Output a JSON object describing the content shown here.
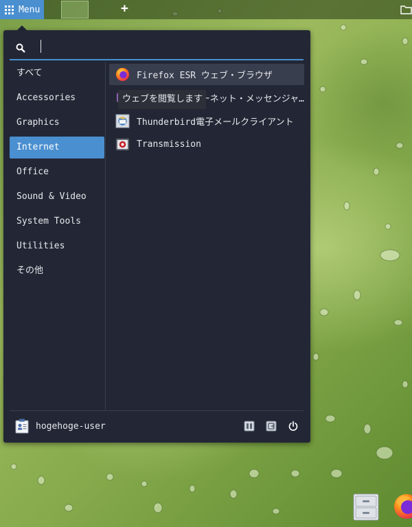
{
  "panel": {
    "menu_label": "Menu",
    "menu_icon": "app-grid-icon",
    "add_icon": "plus-icon",
    "tray_icon": "folder-icon"
  },
  "search": {
    "value": "",
    "placeholder": "",
    "icon": "search-icon"
  },
  "categories": [
    {
      "label": "すべて",
      "active": false
    },
    {
      "label": "Accessories",
      "active": false
    },
    {
      "label": "Graphics",
      "active": false
    },
    {
      "label": "Internet",
      "active": true
    },
    {
      "label": "Office",
      "active": false
    },
    {
      "label": "Sound & Video",
      "active": false
    },
    {
      "label": "System Tools",
      "active": false
    },
    {
      "label": "Utilities",
      "active": false
    },
    {
      "label": "その他",
      "active": false
    }
  ],
  "apps": [
    {
      "label": "Firefox ESR ウェブ・ブラウザ",
      "icon": "firefox-icon",
      "hovered": true
    },
    {
      "label": "Pidgin インターネット・メッセンジャー",
      "icon": "pidgin-icon",
      "hovered": false
    },
    {
      "label": "Thunderbird電子メールクライアント",
      "icon": "thunderbird-icon",
      "hovered": false
    },
    {
      "label": "Transmission",
      "icon": "transmission-icon",
      "hovered": false
    }
  ],
  "tooltip": "ウェブを閲覧します",
  "footer": {
    "user_name": "hogehoge-user",
    "user_icon": "user-card-icon",
    "buttons": [
      "lock-screen-icon",
      "logout-icon",
      "power-icon"
    ]
  },
  "desktop_icons": [
    "file-cabinet-icon",
    "firefox-icon"
  ],
  "colors": {
    "accent": "#4a8fd0",
    "menu_bg": "#232735",
    "hover_bg": "#393e4e",
    "text": "#e6e8ec"
  }
}
